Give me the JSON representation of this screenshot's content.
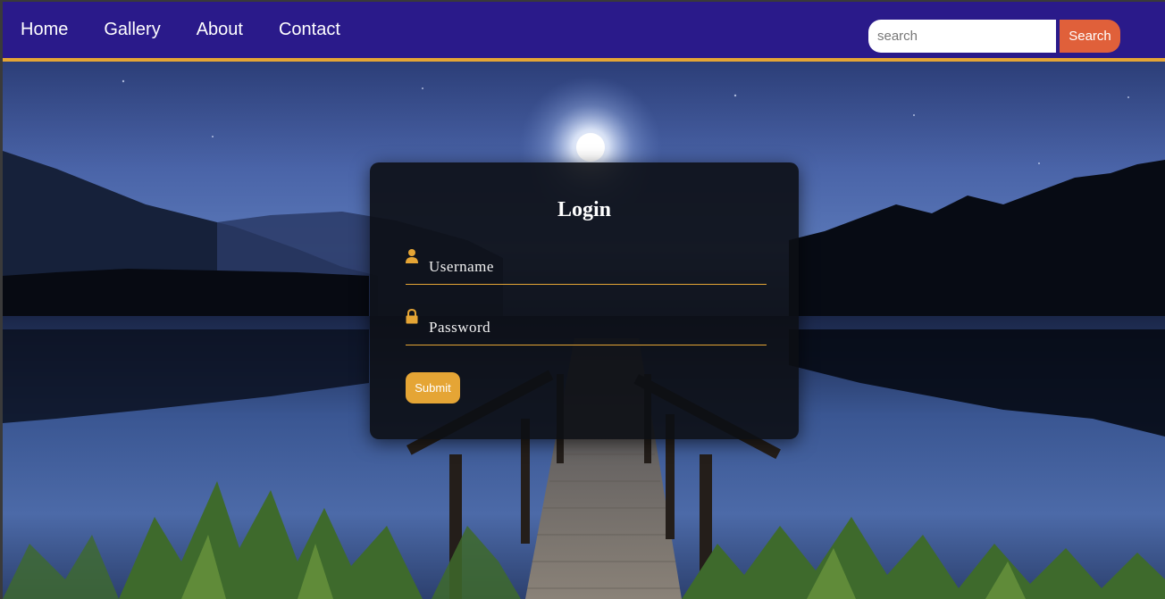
{
  "nav": {
    "links": [
      "Home",
      "Gallery",
      "About",
      "Contact"
    ]
  },
  "search": {
    "placeholder": "search",
    "button_label": "Search"
  },
  "login": {
    "title": "Login",
    "username_placeholder": "Username",
    "password_placeholder": "Password",
    "submit_label": "Submit"
  },
  "colors": {
    "nav_bg": "#2a1a8a",
    "accent": "#e5a535",
    "search_button": "#e0603a",
    "card_bg": "#0c0e14"
  },
  "icons": {
    "username": "user-icon",
    "password": "lock-icon"
  }
}
